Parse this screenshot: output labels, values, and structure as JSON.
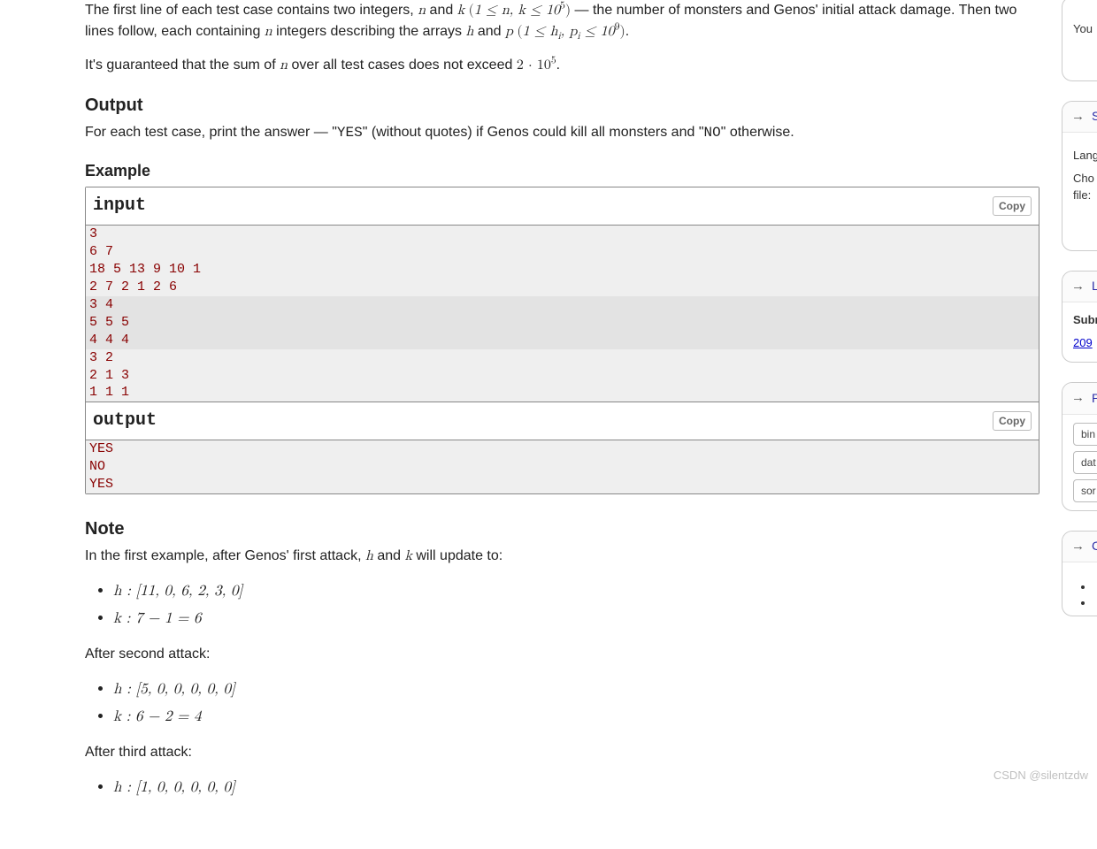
{
  "problem": {
    "input_desc_part1": "The first line of each test case contains two integers, ",
    "input_desc_mid": " — the number of monsters and Genos' initial attack damage. Then two lines follow, each containing ",
    "input_desc_part2": " integers describing the arrays ",
    "input_desc_hp_constraint": ".",
    "nk_1": "n",
    "nk_2": "k",
    "nk_bounds_open": "(",
    "nk_bounds": "1 ≤ n, k ≤ 10",
    "nk_bounds_exp": "5",
    "nk_bounds_close": ")",
    "h_var": "h",
    "p_var": "p",
    "hp_and": " and ",
    "hp_bounds_open": " (",
    "hp_bounds": "1 ≤ h",
    "hp_sub_i1": "i",
    "hp_bounds_mid": ", p",
    "hp_sub_i2": "i",
    "hp_bounds_end": " ≤ 10",
    "hp_bounds_exp": "9",
    "hp_bounds_close": ")",
    "sum_guarantee_pre": "It's guaranteed that the sum of ",
    "sum_guarantee_var": "n",
    "sum_guarantee_mid": " over all test cases does not exceed ",
    "sum_guarantee_num": "2 · 10",
    "sum_guarantee_exp": "5",
    "sum_guarantee_end": "."
  },
  "sections": {
    "output": "Output",
    "output_desc_pre": "For each test case, print the answer — \"",
    "output_desc_yes": "YES",
    "output_desc_mid": "\" (without quotes) if Genos could kill all monsters and \"",
    "output_desc_no": "NO",
    "output_desc_post": "\" otherwise.",
    "example": "Example",
    "note": "Note"
  },
  "example": {
    "input_label": "input",
    "output_label": "output",
    "copy_label": "Copy",
    "input_lines": [
      "3",
      "6 7",
      "18 5 13 9 10 1",
      "2 7 2 1 2 6",
      "3 4",
      "5 5 5",
      "4 4 4",
      "3 2",
      "2 1 3",
      "1 1 1"
    ],
    "output_lines": [
      "YES",
      "NO",
      "YES"
    ]
  },
  "note": {
    "intro_pre": "In the first example, after Genos' first attack, ",
    "intro_h": "h",
    "intro_and": " and ",
    "intro_k": "k",
    "intro_post": " will update to:",
    "step1_h": "h : [11, 0, 6, 2, 3, 0]",
    "step1_k": "k : 7 − 1 = 6",
    "after2": "After second attack:",
    "step2_h": "h : [5, 0, 0, 0, 0, 0]",
    "step2_k": "k : 6 − 2 = 4",
    "after3": "After third attack:",
    "step3_h": "h : [1, 0, 0, 0, 0, 0]"
  },
  "sidebar": {
    "you_text": "You",
    "submit_head_arrow": "→",
    "submit_head": " S",
    "submit_lang_label": "Lang",
    "submit_file_label": "Cho\nfile:",
    "last_head_arrow": "→",
    "last_head": " L",
    "last_sub": "Subm",
    "last_link": "209",
    "tags_head_arrow": "→",
    "tags_head": " P",
    "tag1": "bin",
    "tag2": "dat",
    "tag3": "sor",
    "ann_head_arrow": "→",
    "ann_head": " C"
  },
  "watermark": "CSDN @silentzdw"
}
